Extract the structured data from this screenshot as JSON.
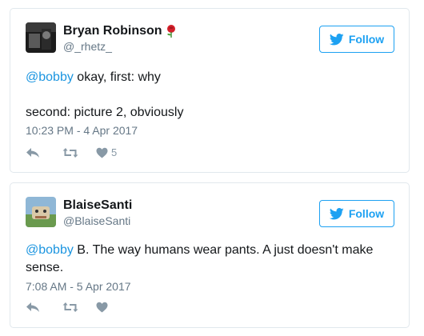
{
  "tweets": [
    {
      "display_name": "Bryan Robinson",
      "handle": "@_rhetz_",
      "emoji_icon": "rose-icon",
      "follow_label": "Follow",
      "mention": "@bobby",
      "text_after_mention": " okay, first: why\n\nsecond: picture 2, obviously",
      "timestamp": "10:23 PM - 4 Apr 2017",
      "like_count": "5"
    },
    {
      "display_name": "BlaiseSanti",
      "handle": "@BlaiseSanti",
      "follow_label": "Follow",
      "mention": "@bobby",
      "text_after_mention": " B. The way humans wear pants. A just doesn't make sense.",
      "timestamp": "7:08 AM - 5 Apr 2017",
      "like_count": ""
    }
  ],
  "colors": {
    "accent": "#1da1f2",
    "mention": "#1b95e0",
    "muted": "#657786",
    "icon": "#8899a6"
  }
}
